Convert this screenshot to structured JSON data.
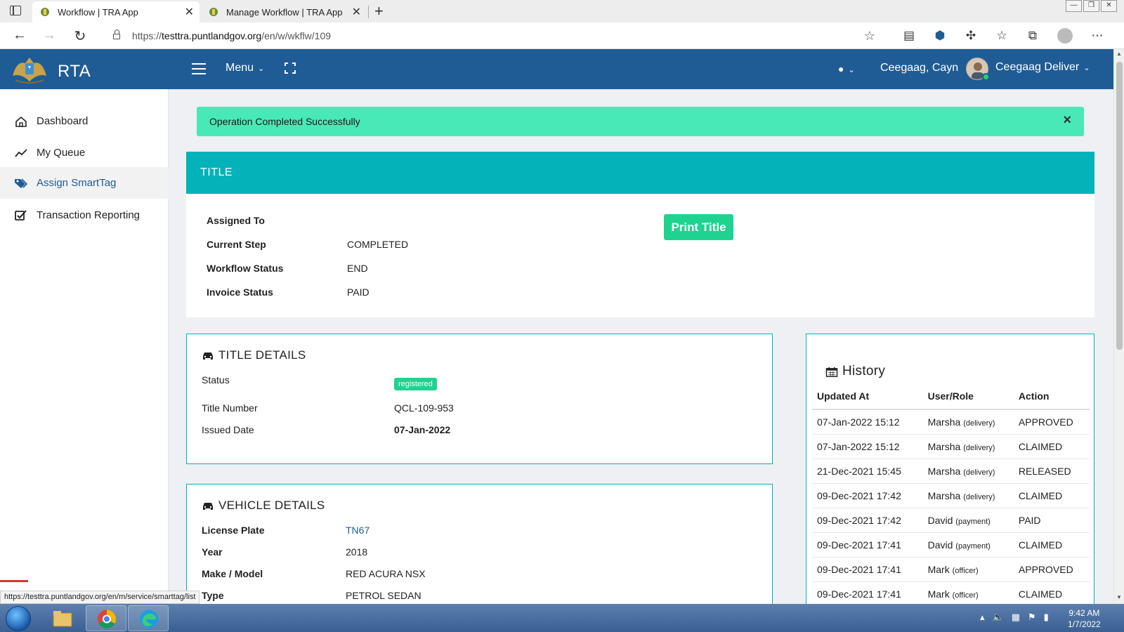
{
  "browser": {
    "tabs": [
      {
        "title": "Workflow | TRA App",
        "active": true
      },
      {
        "title": "Manage Workflow | TRA App",
        "active": false
      }
    ],
    "url_prefix": "https://",
    "url_host": "testtra.puntlandgov.org",
    "url_path": "/en/w/wkflw/109",
    "status_url": "https://testtra.puntlandgov.org/en/m/service/smarttag/list"
  },
  "header": {
    "brand": "RTA",
    "menu_label": "Menu",
    "location": "Ceegaag, Cayn",
    "role": "Ceegaag Deliver",
    "color": "#1f5c96"
  },
  "sidebar": {
    "items": [
      {
        "label": "Dashboard",
        "icon": "home-icon"
      },
      {
        "label": "My Queue",
        "icon": "trend-line-icon"
      },
      {
        "label": "Assign SmartTag",
        "icon": "tags-icon",
        "active": true
      },
      {
        "label": "Transaction Reporting",
        "icon": "check-square-icon"
      }
    ]
  },
  "alert": {
    "message": "Operation Completed Successfully",
    "close": "×"
  },
  "title_card": {
    "heading": "TITLE",
    "fields": [
      {
        "label": "Assigned To",
        "value": ""
      },
      {
        "label": "Current Step",
        "value": "COMPLETED"
      },
      {
        "label": "Workflow Status",
        "value": "END"
      },
      {
        "label": "Invoice Status",
        "value": "PAID"
      }
    ],
    "print_button": "Print Title"
  },
  "title_details": {
    "heading": "TITLE DETAILS",
    "status_label": "Status",
    "status_badge": "registered",
    "title_number_label": "Title Number",
    "title_number": "QCL-109-953",
    "issued_label": "Issued Date",
    "issued_date": "07-Jan-2022"
  },
  "vehicle_details": {
    "heading": "VEHICLE DETAILS",
    "plate_label": "License Plate",
    "plate": "TN67",
    "year_label": "Year",
    "year": "2018",
    "make_label": "Make / Model",
    "make": "RED ACURA NSX",
    "type_label": "Type",
    "type": "PETROL SEDAN"
  },
  "history": {
    "heading": "History",
    "columns": [
      "Updated At",
      "User/Role",
      "Action"
    ],
    "rows": [
      {
        "date": "07-Jan-2022 15:12",
        "user": "Marsha",
        "role": "(delivery)",
        "action": "APPROVED"
      },
      {
        "date": "07-Jan-2022 15:12",
        "user": "Marsha",
        "role": "(delivery)",
        "action": "CLAIMED"
      },
      {
        "date": "21-Dec-2021 15:45",
        "user": "Marsha",
        "role": "(delivery)",
        "action": "RELEASED"
      },
      {
        "date": "09-Dec-2021 17:42",
        "user": "Marsha",
        "role": "(delivery)",
        "action": "CLAIMED"
      },
      {
        "date": "09-Dec-2021 17:42",
        "user": "David",
        "role": "(payment)",
        "action": "PAID"
      },
      {
        "date": "09-Dec-2021 17:41",
        "user": "David",
        "role": "(payment)",
        "action": "CLAIMED"
      },
      {
        "date": "09-Dec-2021 17:41",
        "user": "Mark",
        "role": "(officer)",
        "action": "APPROVED"
      },
      {
        "date": "09-Dec-2021 17:41",
        "user": "Mark",
        "role": "(officer)",
        "action": "CLAIMED"
      }
    ]
  },
  "taskbar": {
    "time": "9:42 AM",
    "date": "1/7/2022"
  }
}
